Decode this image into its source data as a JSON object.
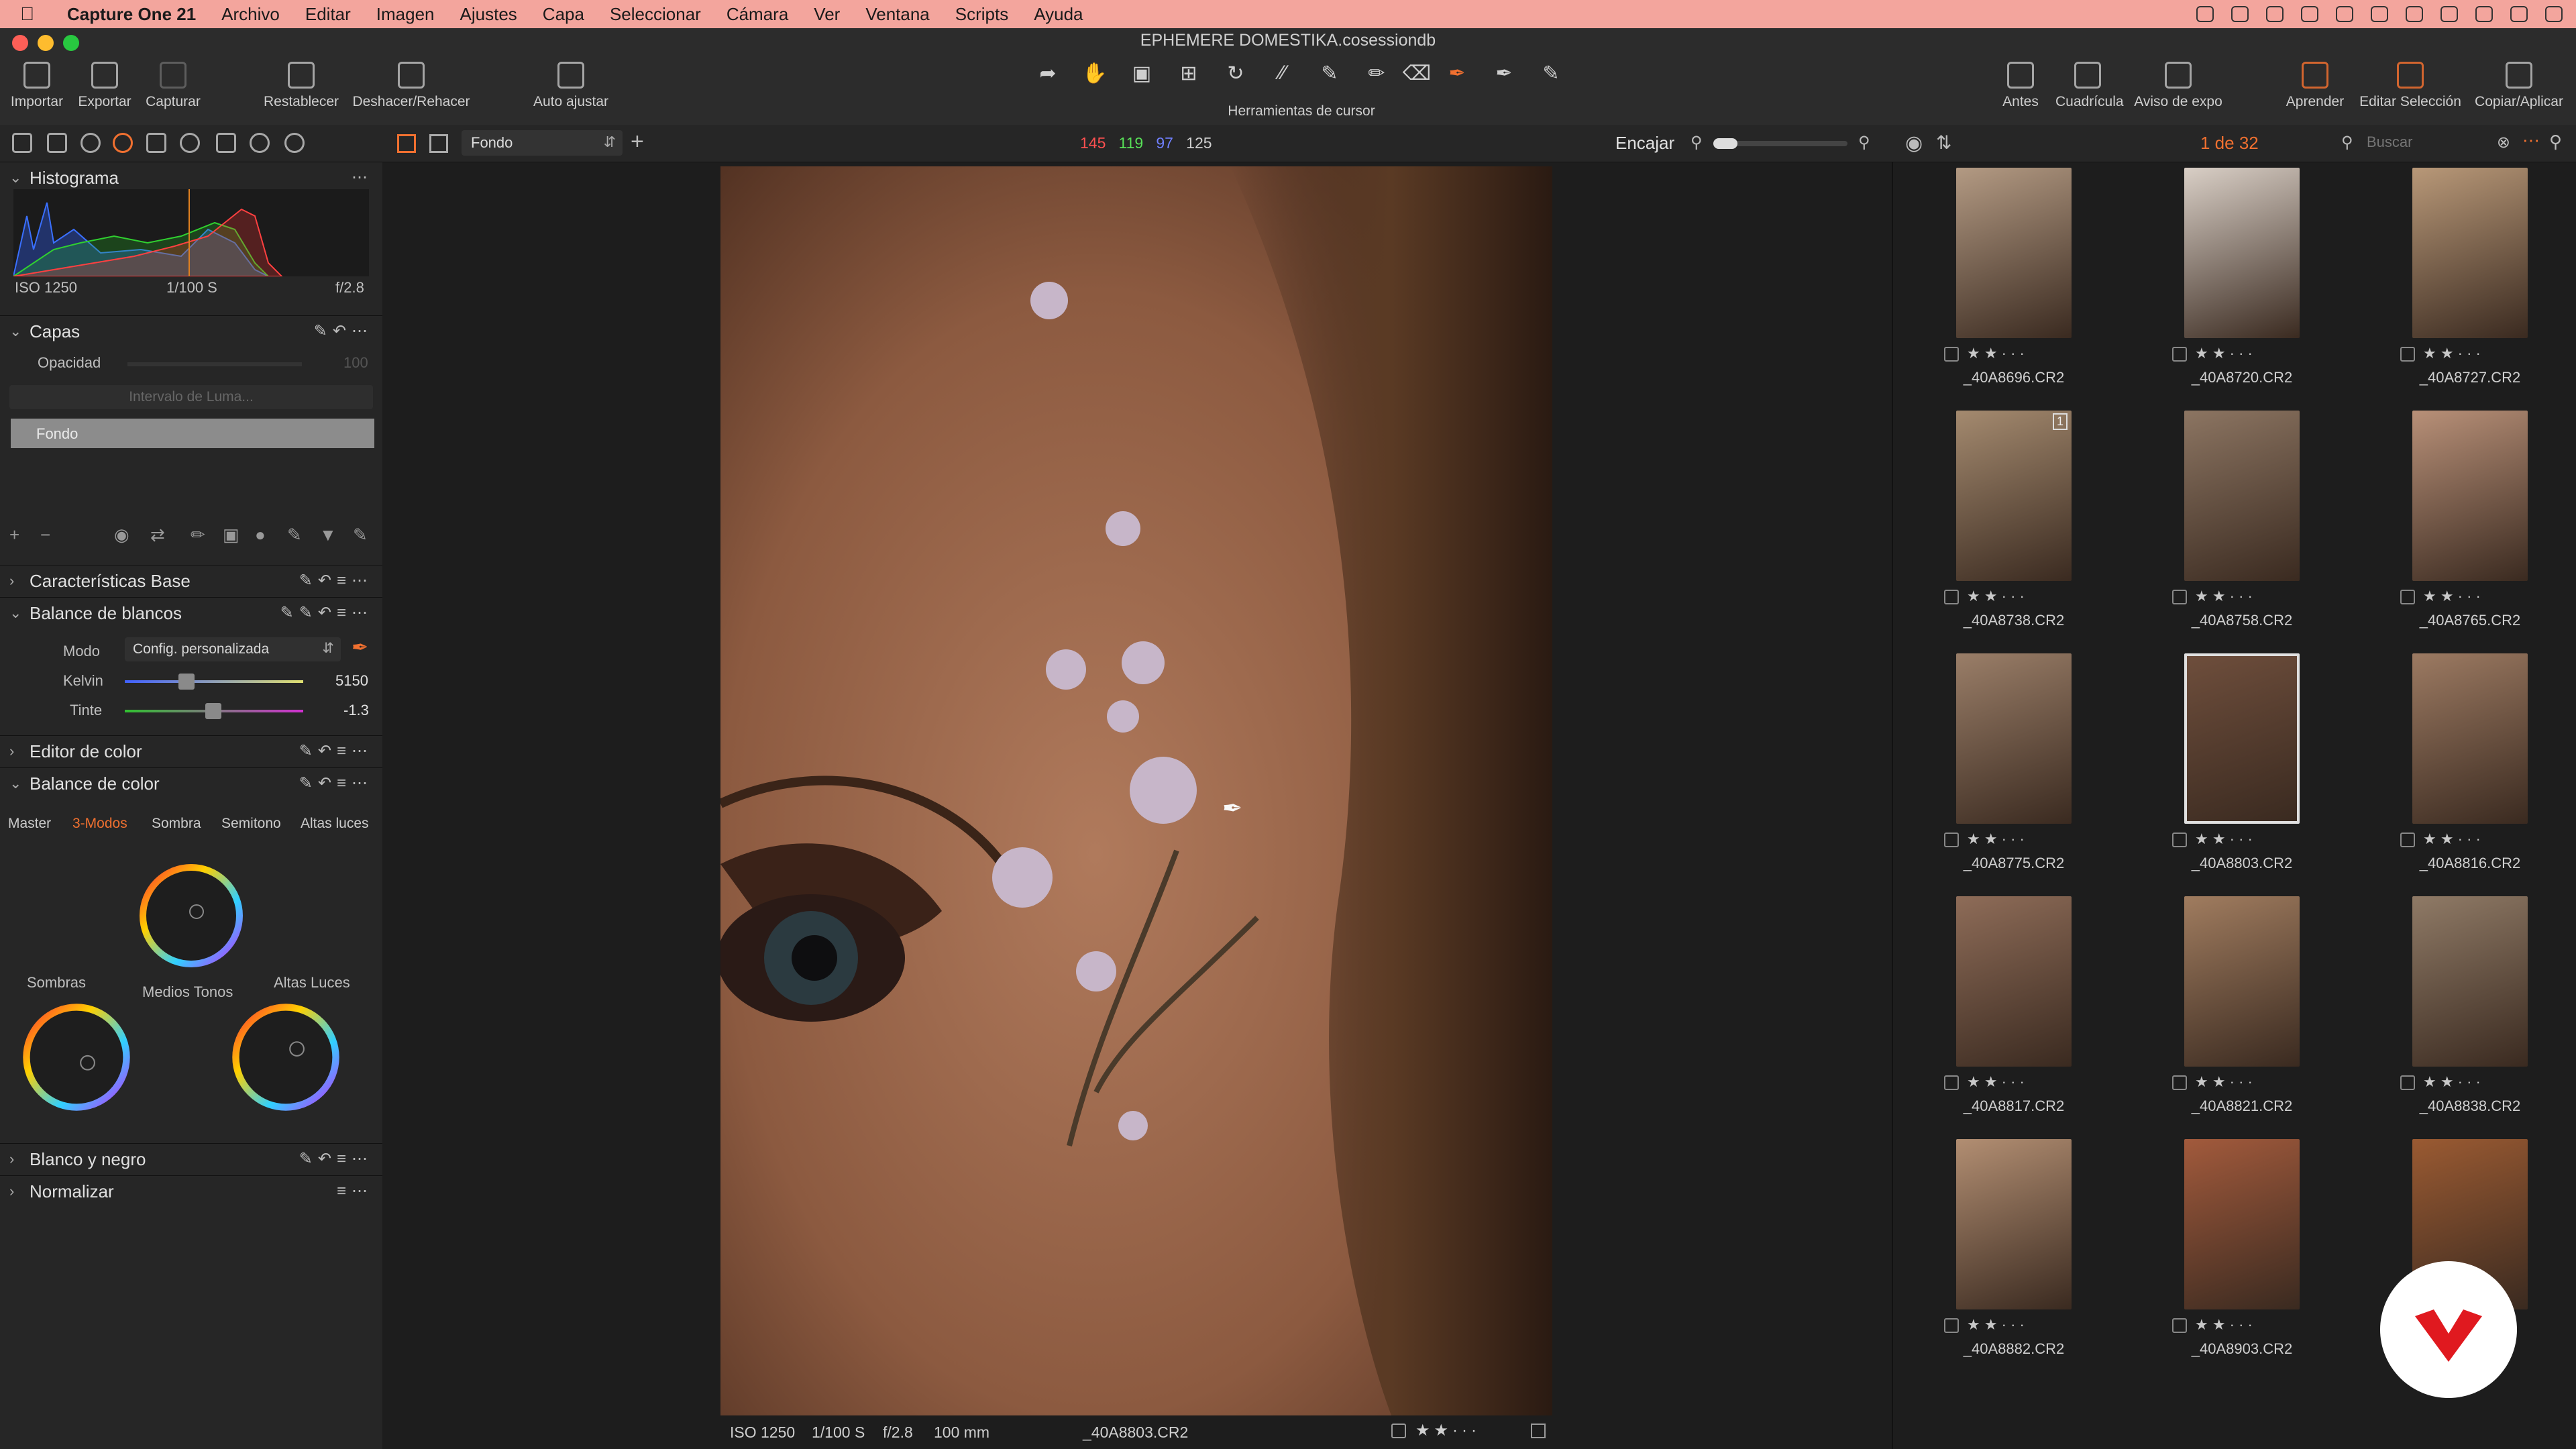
{
  "menubar": {
    "app": "Capture One 21",
    "items": [
      "Archivo",
      "Editar",
      "Imagen",
      "Ajustes",
      "Capa",
      "Seleccionar",
      "Cámara",
      "Ver",
      "Ventana",
      "Scripts",
      "Ayuda"
    ]
  },
  "window": {
    "title": "EPHEMERE DOMESTIKA.cosessiondb"
  },
  "toolbar": {
    "importar": "Importar",
    "exportar": "Exportar",
    "capturar": "Capturar",
    "restablecer": "Restablecer",
    "deshacer": "Deshacer/Rehacer",
    "auto": "Auto ajustar",
    "cursor_tools": "Herramientas de cursor",
    "antes": "Antes",
    "cuadricula": "Cuadrícula",
    "aviso": "Aviso de expo",
    "aprender": "Aprender",
    "editar_sel": "Editar Selección",
    "copiar": "Copiar/Aplicar"
  },
  "viewer_header": {
    "layer_select": "Fondo",
    "rgb": {
      "r": "145",
      "g": "119",
      "b": "97",
      "l": "125"
    },
    "fit": "Encajar"
  },
  "browser_header": {
    "count": "1 de 32",
    "search_placeholder": "Buscar"
  },
  "histogram": {
    "title": "Histograma",
    "iso": "ISO 1250",
    "shutter": "1/100 S",
    "aperture": "f/2.8"
  },
  "capas": {
    "title": "Capas",
    "opacity_label": "Opacidad",
    "opacity_value": "100",
    "luma_button": "Intervalo de Luma...",
    "layer_name": "Fondo"
  },
  "sections": {
    "caracteristicas": "Características Base",
    "balance_blancos": "Balance de blancos",
    "editor_color": "Editor de color",
    "balance_color": "Balance de color",
    "blanco_negro": "Blanco y negro",
    "normalizar": "Normalizar"
  },
  "white_balance": {
    "mode_label": "Modo",
    "mode_value": "Config. personalizada",
    "kelvin_label": "Kelvin",
    "kelvin_value": "5150",
    "tint_label": "Tinte",
    "tint_value": "-1.3"
  },
  "color_balance": {
    "tabs": [
      "Master",
      "3-Modos",
      "Sombra",
      "Semitono",
      "Altas luces"
    ],
    "active_tab": "3-Modos",
    "wheels": {
      "shadows": "Sombras",
      "midtones": "Medios Tonos",
      "highlights": "Altas Luces"
    }
  },
  "viewer_footer": {
    "iso": "ISO 1250",
    "shutter": "1/100 S",
    "aperture": "f/2.8",
    "focal": "100 mm",
    "filename": "_40A8803.CR2"
  },
  "thumbnails": [
    {
      "name": "_40A8696.CR2",
      "tone": "#b39a83"
    },
    {
      "name": "_40A8720.CR2",
      "tone": "#d9cfc6"
    },
    {
      "name": "_40A8727.CR2",
      "tone": "#b89878"
    },
    {
      "name": "_40A8738.CR2",
      "tone": "#a48a6f",
      "badge": "1"
    },
    {
      "name": "_40A8758.CR2",
      "tone": "#8c7562"
    },
    {
      "name": "_40A8765.CR2",
      "tone": "#b89078"
    },
    {
      "name": "_40A8775.CR2",
      "tone": "#9a7e68"
    },
    {
      "name": "_40A8803.CR2",
      "tone": "#6e4e3c",
      "selected": true
    },
    {
      "name": "_40A8816.CR2",
      "tone": "#9c7a62"
    },
    {
      "name": "_40A8817.CR2",
      "tone": "#8e6c58"
    },
    {
      "name": "_40A8821.CR2",
      "tone": "#a07c5f"
    },
    {
      "name": "_40A8838.CR2",
      "tone": "#8f7a66"
    },
    {
      "name": "_40A8882.CR2",
      "tone": "#b28e72"
    },
    {
      "name": "_40A8903.CR2",
      "tone": "#a25a3c"
    },
    {
      "name": "",
      "tone": "#9a5a32"
    }
  ],
  "colors": {
    "accent": "#f07030",
    "menubar": "#f3a59d",
    "brand_badge": "#e0191f"
  }
}
